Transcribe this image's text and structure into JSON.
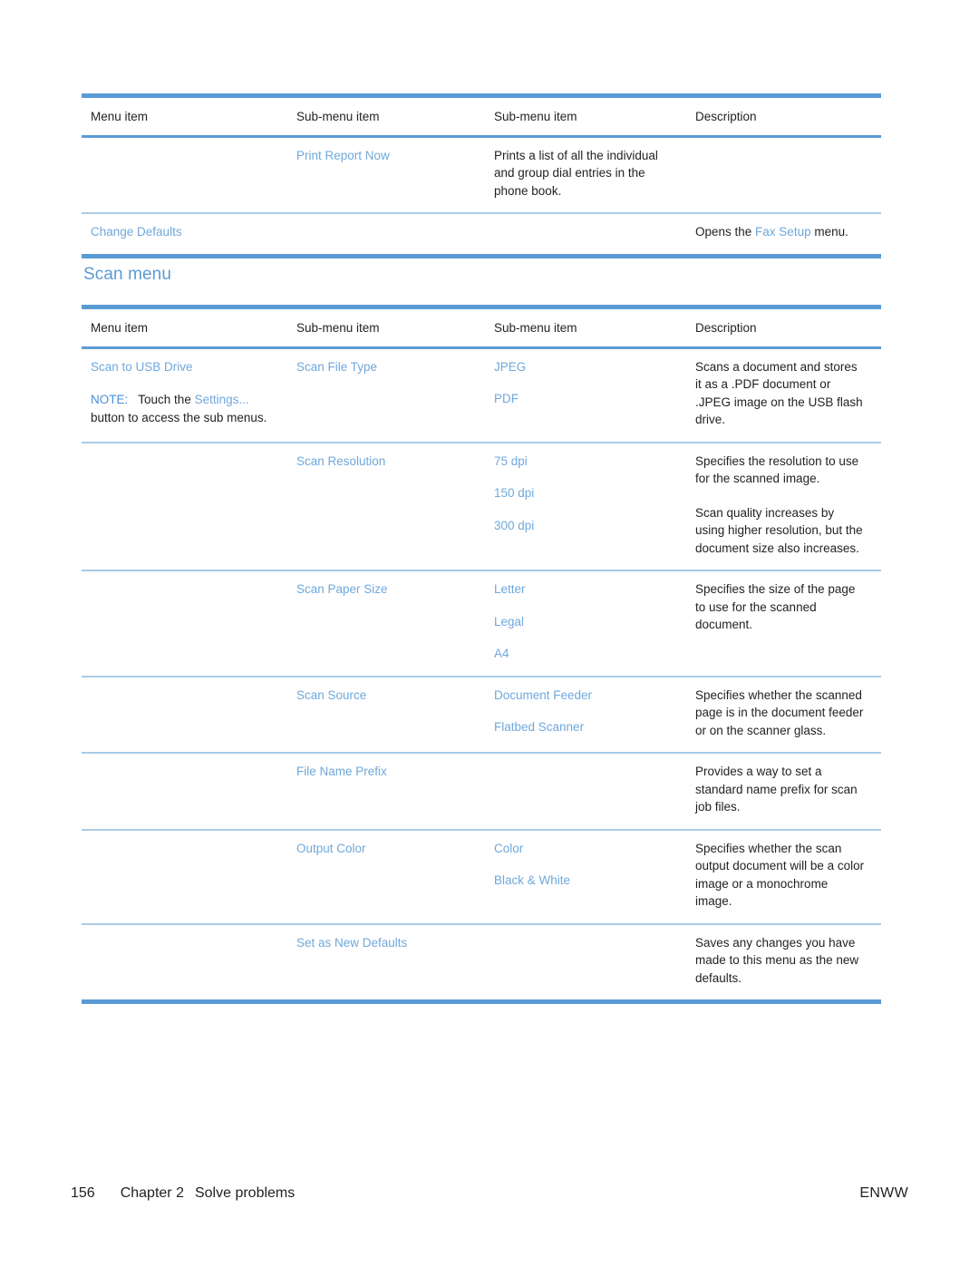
{
  "page": {
    "footer": {
      "page_number": "156",
      "chapter_label": "Chapter 2",
      "chapter_title": "Solve problems",
      "right_label": "ENWW"
    },
    "section_heading": "Scan menu"
  },
  "colors": {
    "accent_blue": "#5b9bd5",
    "link_blue": "#6fa8dc",
    "rule_light_blue": "#a8cce8",
    "text_black": "#231f20"
  },
  "table_headers": {
    "menu_item": "Menu item",
    "sub_menu_item_1": "Sub-menu item",
    "sub_menu_item_2": "Sub-menu item",
    "description": "Description"
  },
  "fax_table": {
    "rows": [
      {
        "menu_item": "",
        "sub_menu_1": "Print Report Now",
        "sub_menu_1b": "",
        "sub_menu_2": "",
        "description_lines": [
          "Prints a list of all the individual and group dial entries in the phone book."
        ]
      },
      {
        "menu_item": "Change Defaults",
        "sub_menu_1": "",
        "sub_menu_2": "",
        "description_pre": "Opens the ",
        "description_link": "Fax Setup",
        "description_post": " menu."
      }
    ]
  },
  "scan_table": {
    "rows": [
      {
        "menu_item": "Scan to USB Drive",
        "note_label": "NOTE:",
        "note_mid": "Touch the ",
        "note_link": "Settings...",
        "note_tail": "button to access the sub menus.",
        "sub_menu_1": "Scan File Type",
        "sub_menu_2_a": "JPEG",
        "sub_menu_2_b": "PDF",
        "description_lines": [
          "Scans a document and stores it as a .PDF document or .JPEG image on the USB flash drive."
        ]
      },
      {
        "menu_item": "",
        "sub_menu_1": "Scan Resolution",
        "sub_menu_2_a": "75 dpi",
        "sub_menu_2_b": "150 dpi",
        "sub_menu_2_c": "300 dpi",
        "description_lines": [
          "Specifies the resolution to use for the scanned image.",
          "Scan quality increases by using higher resolution, but the document size also increases."
        ]
      },
      {
        "menu_item": "",
        "sub_menu_1": "Scan Paper Size",
        "sub_menu_2_a": "Letter",
        "sub_menu_2_b": "Legal",
        "sub_menu_2_c": "A4",
        "description_lines": [
          "Specifies the size of the page to use for the scanned document."
        ]
      },
      {
        "menu_item": "",
        "sub_menu_1": "Scan Source",
        "sub_menu_2_a": "Document Feeder",
        "sub_menu_2_b": "Flatbed Scanner",
        "description_lines": [
          "Specifies whether the scanned page is in the document feeder or on the scanner glass."
        ]
      },
      {
        "menu_item": "",
        "sub_menu_1": "File Name Prefix",
        "sub_menu_2_a": "",
        "description_lines": [
          "Provides a way to set a standard name prefix for scan job files."
        ]
      },
      {
        "menu_item": "",
        "sub_menu_1": "Output Color",
        "sub_menu_2_a": "Color",
        "sub_menu_2_b": "Black & White",
        "description_lines": [
          "Specifies whether the scan output document will be a color image or a monochrome image."
        ]
      },
      {
        "menu_item": "",
        "sub_menu_1": "Set as New Defaults",
        "sub_menu_2_a": "",
        "description_lines": [
          "Saves any changes you have made to this menu as the new defaults."
        ]
      }
    ]
  }
}
